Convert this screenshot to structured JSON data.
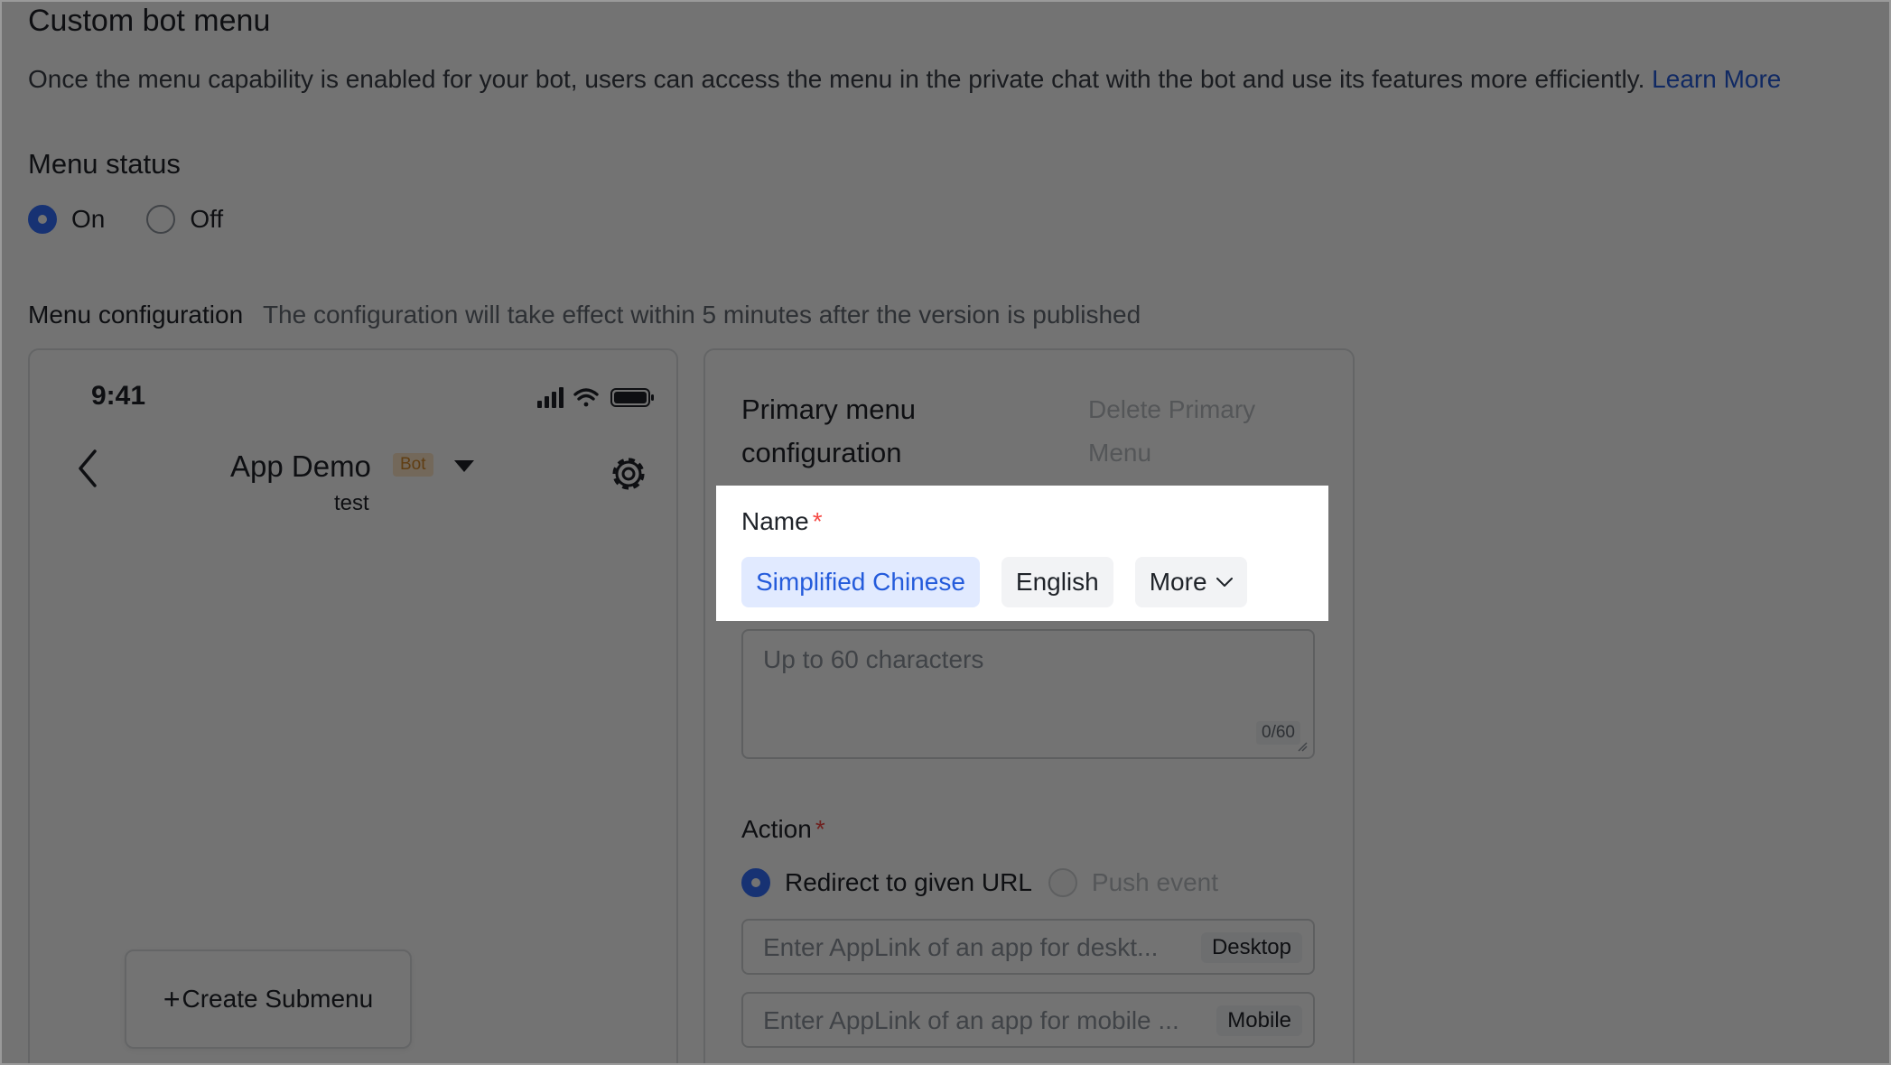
{
  "section": {
    "title": "Custom bot menu",
    "description": "Once the menu capability is enabled for your bot, users can access the menu in the private chat with the bot and use its features more efficiently.",
    "learn_more": "Learn More"
  },
  "menu_status": {
    "title": "Menu status",
    "options": [
      {
        "label": "On",
        "selected": true
      },
      {
        "label": "Off",
        "selected": false
      }
    ]
  },
  "menu_configuration": {
    "title": "Menu configuration",
    "note": "The configuration will take effect within 5 minutes after the version is published"
  },
  "phone_preview": {
    "time": "9:41",
    "app_name": "App Demo",
    "bot_badge": "Bot",
    "subtitle": "test",
    "create_submenu": "Create Submenu",
    "icons": [
      "signal-icon",
      "wifi-icon",
      "battery-icon",
      "back-arrow-icon",
      "dropdown-caret-icon",
      "gear-icon",
      "plus-icon"
    ]
  },
  "config_panel": {
    "title_line1": "Primary menu",
    "title_line2": "configuration",
    "delete_line1": "Delete Primary",
    "delete_line2": "Menu",
    "name": {
      "label": "Name",
      "required_mark": "*",
      "languages": [
        {
          "label": "Simplified Chinese",
          "active": true
        },
        {
          "label": "English",
          "active": false
        },
        {
          "label": "More",
          "active": false
        }
      ],
      "placeholder": "Up to 60 characters",
      "count": "0/60"
    },
    "action": {
      "label": "Action",
      "required_mark": "*",
      "options": [
        {
          "label": "Redirect to given URL",
          "selected": true
        },
        {
          "label": "Push event",
          "selected": false,
          "disabled": true
        }
      ],
      "desktop_placeholder": "Enter AppLink of an app for deskt...",
      "desktop_tag": "Desktop",
      "mobile_placeholder": "Enter AppLink of an app for mobile ...",
      "mobile_tag": "Mobile"
    }
  },
  "colors": {
    "accent": "#3370ff",
    "link": "#245bdb",
    "required": "#f54a45",
    "overlay": "rgba(0,0,0,0.55)"
  }
}
